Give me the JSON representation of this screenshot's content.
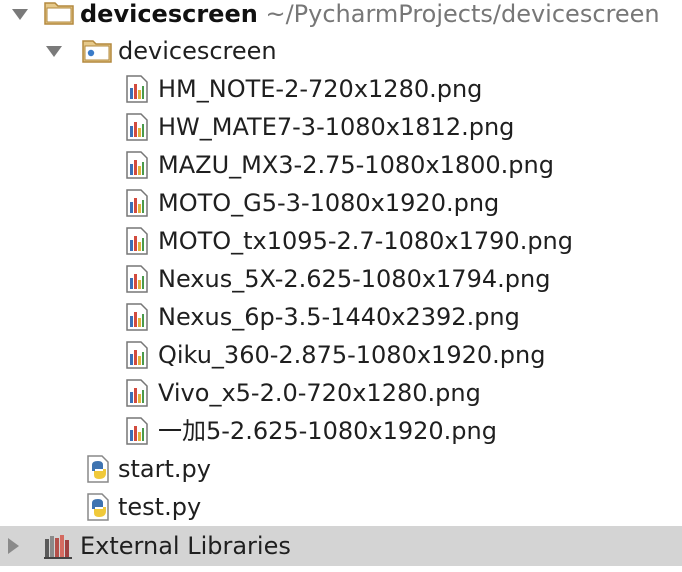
{
  "project_tree": {
    "root": {
      "name": "devicescreen",
      "path": "~/PycharmProjects/devicescreen",
      "expanded": true
    },
    "package": {
      "name": "devicescreen",
      "expanded": true
    },
    "files": [
      {
        "name": "HM_NOTE-2-720x1280.png",
        "icon": "png-image-icon"
      },
      {
        "name": "HW_MATE7-3-1080x1812.png",
        "icon": "png-image-icon"
      },
      {
        "name": "MAZU_MX3-2.75-1080x1800.png",
        "icon": "png-image-icon"
      },
      {
        "name": "MOTO_G5-3-1080x1920.png",
        "icon": "png-image-icon"
      },
      {
        "name": "MOTO_tx1095-2.7-1080x1790.png",
        "icon": "png-image-icon"
      },
      {
        "name": "Nexus_5X-2.625-1080x1794.png",
        "icon": "png-image-icon"
      },
      {
        "name": "Nexus_6p-3.5-1440x2392.png",
        "icon": "png-image-icon"
      },
      {
        "name": "Qiku_360-2.875-1080x1920.png",
        "icon": "png-image-icon"
      },
      {
        "name": "Vivo_x5-2.0-720x1280.png",
        "icon": "png-image-icon"
      },
      {
        "name": "一加5-2.625-1080x1920.png",
        "icon": "png-image-icon"
      }
    ],
    "scripts": [
      {
        "name": "start.py",
        "icon": "python-file-icon"
      },
      {
        "name": "test.py",
        "icon": "python-file-icon"
      }
    ],
    "external_libraries": {
      "name": "External Libraries",
      "expanded": false
    }
  },
  "colors": {
    "folder": "#c8a15a",
    "package_dot": "#3a7bc8",
    "selected_background": "#d4d4d4",
    "path_text": "#777777"
  }
}
